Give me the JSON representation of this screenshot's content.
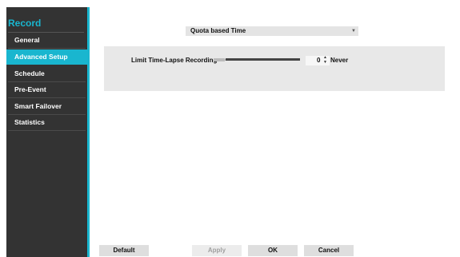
{
  "sidebar": {
    "title": "Record",
    "items": [
      {
        "label": "General"
      },
      {
        "label": "Advanced Setup"
      },
      {
        "label": "Schedule"
      },
      {
        "label": "Pre-Event"
      },
      {
        "label": "Smart Failover"
      },
      {
        "label": "Statistics"
      }
    ],
    "active_item": "Advanced Setup"
  },
  "main": {
    "mode_select": {
      "value": "Quota based Time"
    },
    "time_lapse": {
      "label": "Limit Time-Lapse Recording",
      "value": "0",
      "unit_text": "Never",
      "slider_level": 0
    }
  },
  "footer": {
    "default_label": "Default",
    "apply_label": "Apply",
    "ok_label": "OK",
    "cancel_label": "Cancel"
  },
  "colors": {
    "accent": "#19b6cf",
    "sidebar_bg": "#333333"
  }
}
